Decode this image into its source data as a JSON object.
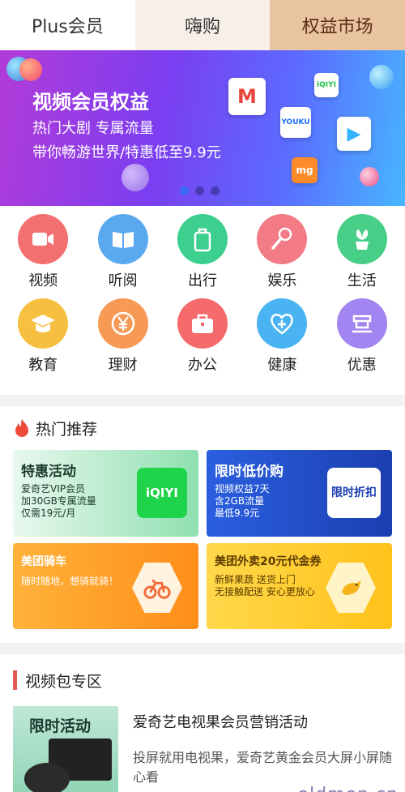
{
  "tabs": [
    {
      "label": "Plus会员"
    },
    {
      "label": "嗨购"
    },
    {
      "label": "权益市场"
    }
  ],
  "banner": {
    "title": "视频会员权益",
    "line1": "热门大剧 专属流量",
    "line2": "带你畅游世界/特惠低至9.9元",
    "apps": [
      "M",
      "iQIYI",
      "YOUKU",
      "▶",
      "mg"
    ]
  },
  "grid": [
    {
      "label": "视频",
      "icon": "video-icon",
      "color": "#f2706f"
    },
    {
      "label": "听阅",
      "icon": "book-icon",
      "color": "#5aa9ef"
    },
    {
      "label": "出行",
      "icon": "luggage-icon",
      "color": "#3ccf8e"
    },
    {
      "label": "娱乐",
      "icon": "microphone-icon",
      "color": "#f27b86"
    },
    {
      "label": "生活",
      "icon": "plant-icon",
      "color": "#48cf87"
    },
    {
      "label": "教育",
      "icon": "graduation-cap-icon",
      "color": "#f6bf3f"
    },
    {
      "label": "理财",
      "icon": "yen-coin-icon",
      "color": "#f79a56"
    },
    {
      "label": "办公",
      "icon": "briefcase-icon",
      "color": "#f56a6a"
    },
    {
      "label": "健康",
      "icon": "heart-plus-icon",
      "color": "#4ab4f2"
    },
    {
      "label": "优惠",
      "icon": "coupon-icon",
      "color": "#a285f1"
    }
  ],
  "hot": {
    "title": "热门推荐",
    "cards": [
      {
        "title": "特惠活动",
        "lines": [
          "爱奇艺VIP会员",
          "加30GB专属流量",
          "仅需19元/月"
        ],
        "art": "iQIYI"
      },
      {
        "title": "限时低价购",
        "lines": [
          "视频权益7天",
          "含2GB流量",
          "最低9.9元"
        ],
        "art": "限时折扣"
      },
      {
        "title": "美团骑车",
        "lines": [
          "随时随地，想骑就骑！"
        ],
        "art": "bike"
      },
      {
        "title": "美团外卖20元代金券",
        "lines": [
          "新鲜果蔬 送货上门",
          "无接触配送 安心更放心"
        ],
        "art": "kangaroo"
      }
    ]
  },
  "video_zone": {
    "title": "视频包专区",
    "item": {
      "poster_title": "限时活动",
      "title": "爱奇艺电视果会员营销活动",
      "desc": "投屏就用电视果，爱奇艺黄金会员大屏小屏随心看"
    }
  },
  "watermark": "oldmen.cn",
  "colors": {
    "accent_tab": "#e8c4a0",
    "hot_flame": "#f04a3a",
    "zone_bar": "#e05a55"
  }
}
